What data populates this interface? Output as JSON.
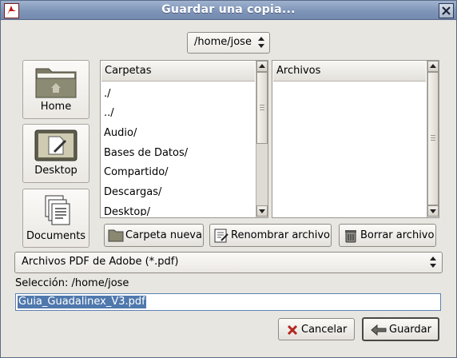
{
  "window": {
    "title": "Guardar una copia..."
  },
  "path": {
    "current": "/home/jose"
  },
  "places": [
    {
      "label": "Home",
      "icon": "home-folder-icon"
    },
    {
      "label": "Desktop",
      "icon": "desktop-icon"
    },
    {
      "label": "Documents",
      "icon": "documents-icon"
    }
  ],
  "folders": {
    "header": "Carpetas",
    "items": [
      "./",
      "../",
      "Audio/",
      "Bases de Datos/",
      "Compartido/",
      "Descargas/",
      "Desktop/"
    ]
  },
  "files": {
    "header": "Archivos",
    "items": []
  },
  "actions": {
    "new_folder": "Carpeta nueva",
    "rename_file": "Renombrar archivo",
    "delete_file": "Borrar archivo"
  },
  "filter": {
    "selected": "Archivos PDF de Adobe (*.pdf)"
  },
  "selection": {
    "label": "Selección: /home/jose",
    "filename": "Guia_Guadalinex_V3.pdf"
  },
  "buttons": {
    "cancel": "Cancelar",
    "save": "Guardar"
  },
  "colors": {
    "titlebar": "#7f95b8",
    "selection": "#4f78ad"
  }
}
